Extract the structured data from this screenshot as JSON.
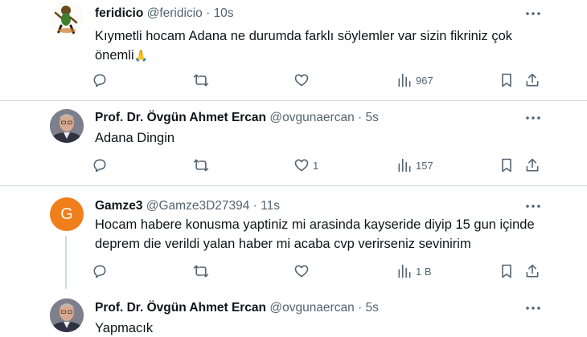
{
  "tweets": [
    {
      "name": "feridicio",
      "handle": "@feridicio",
      "sep": "·",
      "time": "10s",
      "text_line1": "Kıymetli hocam Adana ne durumda farklı söylemler var sizin fikriniz çok",
      "text_line2": "önemli",
      "emoji": "🙏",
      "avatar_icon": "cartoon-figure-avatar",
      "reply_count": "",
      "retweet_count": "",
      "like_count": "",
      "view_count": "967"
    },
    {
      "name": "Prof. Dr. Övgün Ahmet Ercan",
      "handle": "@ovgunaercan",
      "sep": "·",
      "time": "5s",
      "text_line1": "Adana Dingin",
      "avatar_icon": "man-portrait-avatar",
      "reply_count": "",
      "retweet_count": "",
      "like_count": "1",
      "view_count": "157"
    },
    {
      "name": "Gamze3",
      "handle": "@Gamze3D27394",
      "sep": "·",
      "time": "11s",
      "text_line1": "Hocam habere konusma yaptiniz mi arasinda kayseride diyip 15 gun içinde",
      "text_line2": "deprem die verildi yalan haber mi acaba cvp verirseniz sevinirim",
      "avatar_letter": "G",
      "avatar_color": "#ef7f1a",
      "reply_count": "",
      "retweet_count": "",
      "like_count": "",
      "view_count": "1 B"
    },
    {
      "name": "Prof. Dr. Övgün Ahmet Ercan",
      "handle": "@ovgunaercan",
      "sep": "·",
      "time": "5s",
      "text_line1": "Yapmacık",
      "avatar_icon": "man-portrait-avatar"
    }
  ],
  "colors": {
    "text_primary": "#0f1419",
    "text_secondary": "#536471",
    "divider": "#cfd9de"
  }
}
